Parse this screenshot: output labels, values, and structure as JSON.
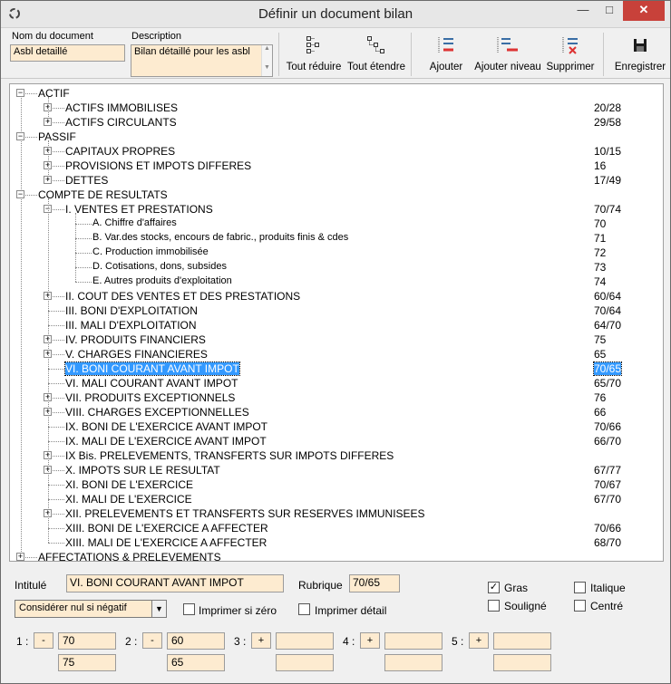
{
  "window": {
    "title": "Définir un document bilan"
  },
  "header": {
    "doc_name_label": "Nom du document",
    "doc_name_value": "Asbl detaillé",
    "description_label": "Description",
    "description_value": "Bilan détaillé pour les asbl"
  },
  "toolbar": {
    "collapse_all": "Tout réduire",
    "expand_all": "Tout étendre",
    "add": "Ajouter",
    "add_level": "Ajouter niveau",
    "delete": "Supprimer",
    "save": "Enregistrer"
  },
  "tree": [
    {
      "label": "ACTIF",
      "rubrique": "",
      "level": 0,
      "expander": "-"
    },
    {
      "label": "ACTIFS IMMOBILISES",
      "rubrique": "20/28",
      "level": 1,
      "expander": "+"
    },
    {
      "label": "ACTIFS CIRCULANTS",
      "rubrique": "29/58",
      "level": 1,
      "expander": "+"
    },
    {
      "label": "PASSIF",
      "rubrique": "",
      "level": 0,
      "expander": "-"
    },
    {
      "label": "CAPITAUX PROPRES",
      "rubrique": "10/15",
      "level": 1,
      "expander": "+"
    },
    {
      "label": "PROVISIONS ET IMPOTS DIFFERES",
      "rubrique": "16",
      "level": 1,
      "expander": "+"
    },
    {
      "label": "DETTES",
      "rubrique": "17/49",
      "level": 1,
      "expander": "+"
    },
    {
      "label": "COMPTE DE RESULTATS",
      "rubrique": "",
      "level": 0,
      "expander": "-"
    },
    {
      "label": "I. VENTES ET PRESTATIONS",
      "rubrique": "70/74",
      "level": 1,
      "expander": "-"
    },
    {
      "label": "A. Chiffre d'affaires",
      "rubrique": "70",
      "level": 2,
      "expander": "",
      "small": true
    },
    {
      "label": "B. Var.des stocks, encours de fabric., produits finis & cdes",
      "rubrique": "71",
      "level": 2,
      "expander": "",
      "small": true
    },
    {
      "label": "C. Production immobilisée",
      "rubrique": "72",
      "level": 2,
      "expander": "",
      "small": true
    },
    {
      "label": "D. Cotisations, dons, subsides",
      "rubrique": "73",
      "level": 2,
      "expander": "",
      "small": true
    },
    {
      "label": "E. Autres produits d'exploitation",
      "rubrique": "74",
      "level": 2,
      "expander": "",
      "small": true
    },
    {
      "label": "II. COUT DES VENTES ET DES PRESTATIONS",
      "rubrique": "60/64",
      "level": 1,
      "expander": "+"
    },
    {
      "label": "III. BONI D'EXPLOITATION",
      "rubrique": "70/64",
      "level": 1,
      "expander": ""
    },
    {
      "label": "III. MALI D'EXPLOITATION",
      "rubrique": "64/70",
      "level": 1,
      "expander": ""
    },
    {
      "label": "IV. PRODUITS FINANCIERS",
      "rubrique": "75",
      "level": 1,
      "expander": "+"
    },
    {
      "label": "V. CHARGES FINANCIERES",
      "rubrique": "65",
      "level": 1,
      "expander": "+"
    },
    {
      "label": "VI. BONI COURANT AVANT IMPOT",
      "rubrique": "70/65",
      "level": 1,
      "expander": "",
      "selected": true
    },
    {
      "label": "VI. MALI COURANT AVANT IMPOT",
      "rubrique": "65/70",
      "level": 1,
      "expander": ""
    },
    {
      "label": "VII. PRODUITS EXCEPTIONNELS",
      "rubrique": "76",
      "level": 1,
      "expander": "+"
    },
    {
      "label": "VIII. CHARGES EXCEPTIONNELLES",
      "rubrique": "66",
      "level": 1,
      "expander": "+"
    },
    {
      "label": "IX. BONI DE L'EXERCICE AVANT IMPOT",
      "rubrique": "70/66",
      "level": 1,
      "expander": ""
    },
    {
      "label": "IX. MALI DE L'EXERCICE AVANT IMPOT",
      "rubrique": "66/70",
      "level": 1,
      "expander": ""
    },
    {
      "label": "IX Bis. PRELEVEMENTS, TRANSFERTS SUR IMPOTS DIFFERES",
      "rubrique": "",
      "level": 1,
      "expander": "+"
    },
    {
      "label": "X. IMPOTS SUR LE RESULTAT",
      "rubrique": "67/77",
      "level": 1,
      "expander": "+"
    },
    {
      "label": "XI. BONI DE L'EXERCICE",
      "rubrique": "70/67",
      "level": 1,
      "expander": ""
    },
    {
      "label": "XI. MALI DE L'EXERCICE",
      "rubrique": "67/70",
      "level": 1,
      "expander": ""
    },
    {
      "label": "XII. PRELEVEMENTS ET TRANSFERTS SUR RESERVES IMMUNISEES",
      "rubrique": "",
      "level": 1,
      "expander": "+"
    },
    {
      "label": "XIII. BONI DE L'EXERCICE A AFFECTER",
      "rubrique": "70/66",
      "level": 1,
      "expander": ""
    },
    {
      "label": "XIII. MALI DE L'EXERCICE A AFFECTER",
      "rubrique": "68/70",
      "level": 1,
      "expander": ""
    },
    {
      "label": "AFFECTATIONS & PRELEVEMENTS",
      "rubrique": "",
      "level": 0,
      "expander": "+"
    }
  ],
  "detail": {
    "intitule_label": "Intitulé",
    "intitule_value": "VI. BONI COURANT AVANT IMPOT",
    "rubrique_label": "Rubrique",
    "rubrique_value": "70/65",
    "mode_value": "Considérer nul si négatif",
    "print_if_zero": "Imprimer si zéro",
    "print_detail": "Imprimer détail",
    "bold": "Gras",
    "italic": "Italique",
    "underline": "Souligné",
    "centered": "Centré",
    "bold_checked": true,
    "groups": [
      {
        "label": "1 :",
        "sign": "-",
        "v1": "70",
        "v2": "75"
      },
      {
        "label": "2 :",
        "sign": "-",
        "v1": "60",
        "v2": "65"
      },
      {
        "label": "3 :",
        "sign": "+",
        "v1": "",
        "v2": ""
      },
      {
        "label": "4 :",
        "sign": "+",
        "v1": "",
        "v2": ""
      },
      {
        "label": "5 :",
        "sign": "+",
        "v1": "",
        "v2": ""
      }
    ]
  }
}
